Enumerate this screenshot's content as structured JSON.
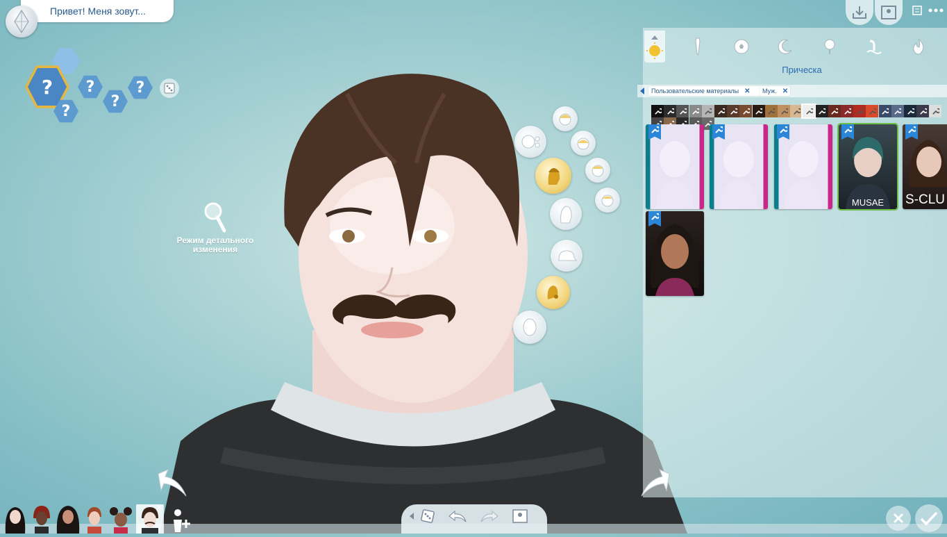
{
  "header": {
    "name_placeholder": "Привет! Меня зовут..."
  },
  "aspiration": {
    "placeholder_glyph": "?"
  },
  "detail_mode": {
    "label": "Режим детального изменения"
  },
  "panel": {
    "title": "Прическа",
    "filters": [
      {
        "label": "Пользовательские материалы"
      },
      {
        "label": "Муж."
      }
    ],
    "tabs": [
      "sun-icon",
      "tie-icon",
      "ball-icon",
      "moon-icon",
      "tree-icon",
      "pool-icon",
      "fire-icon"
    ],
    "items": [
      {
        "label": "",
        "style": "bust"
      },
      {
        "label": "",
        "style": "bust"
      },
      {
        "label": "",
        "style": "bust"
      },
      {
        "label": "MUSAE",
        "style": "teal-hair",
        "selected": true
      },
      {
        "label": "S-CLU",
        "style": "woman"
      },
      {
        "label": "",
        "style": "curly"
      }
    ]
  },
  "swatch_colors_row1": [
    "#111111",
    "#2b2b2b",
    "#555555",
    "#8a8a8a",
    "#b5b5b5",
    "#3a2a20",
    "#5a3a2a",
    "#7a4a30",
    "#2a1a14",
    "#a0703a",
    "#c09060",
    "#d8b890",
    "#eeeeee",
    "#222222",
    "#6a2a20",
    "#8a2a2a",
    "#b02a20",
    "#d84a2a",
    "#3a4a6a",
    "#5a6a8a",
    "#1a2a3a",
    "#3a3a4a",
    "#dddddd"
  ],
  "swatch_colors_row2": [
    "#444444",
    "#8a6a4a",
    "#2a2a2a",
    "#5a5a5a",
    "#6a6a6a"
  ],
  "colors": {
    "accent_blue": "#2a6ab0",
    "selected_green": "#6cc04a",
    "badge_blue": "#2c86d8"
  }
}
